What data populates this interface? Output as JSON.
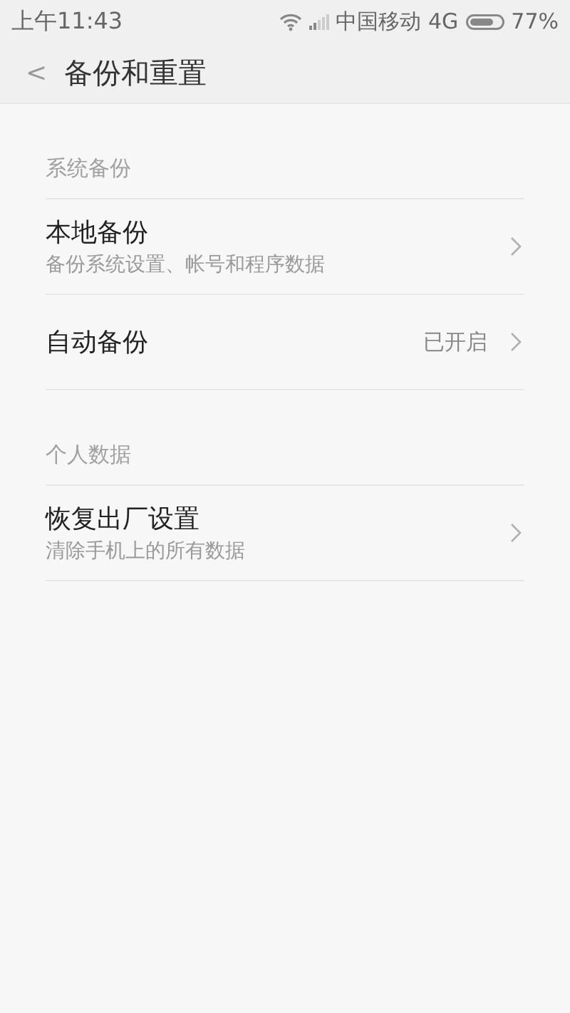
{
  "status_bar": {
    "time": "上午11:43",
    "carrier": "中国移动 4G",
    "battery": "77%"
  },
  "header": {
    "back": "<",
    "title": "备份和重置"
  },
  "sections": [
    {
      "title": "系统备份",
      "items": [
        {
          "title": "本地备份",
          "subtitle": "备份系统设置、帐号和程序数据"
        },
        {
          "title": "自动备份",
          "value": "已开启"
        }
      ]
    },
    {
      "title": "个人数据",
      "items": [
        {
          "title": "恢复出厂设置",
          "subtitle": "清除手机上的所有数据"
        }
      ]
    }
  ]
}
